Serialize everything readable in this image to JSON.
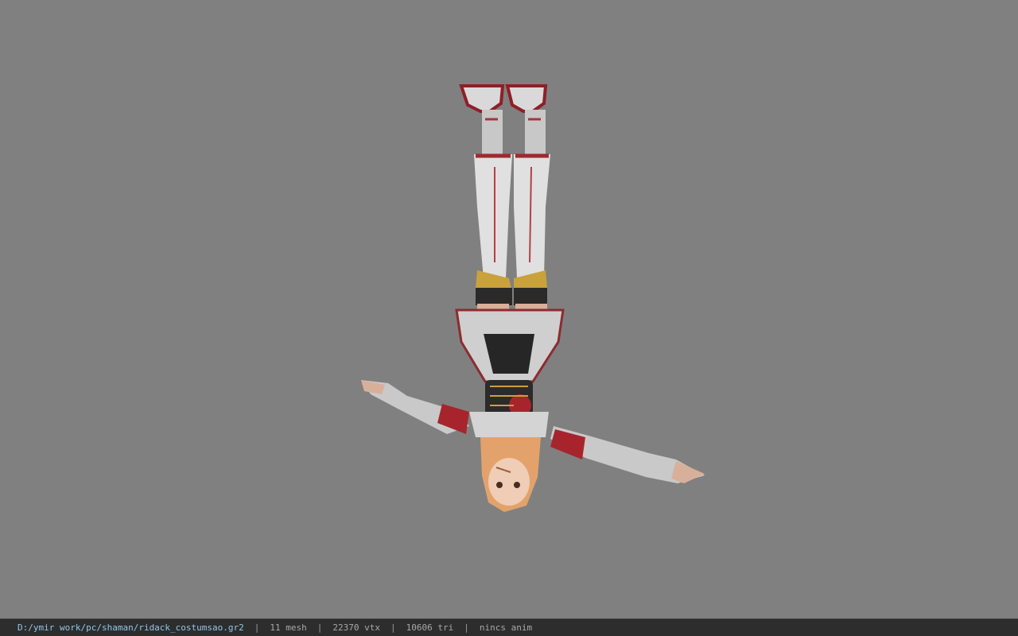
{
  "viewer": {
    "background_color": "#808080",
    "model_name": "character-model",
    "model_orientation": "upside-down"
  },
  "status": {
    "file_path": "D:/ymir work/pc/shaman/ridack_costumsao.gr2",
    "separator": "|",
    "mesh": "11 mesh",
    "vtx": "22370 vtx",
    "tri": "10606 tri",
    "anim": "nincs anim"
  }
}
